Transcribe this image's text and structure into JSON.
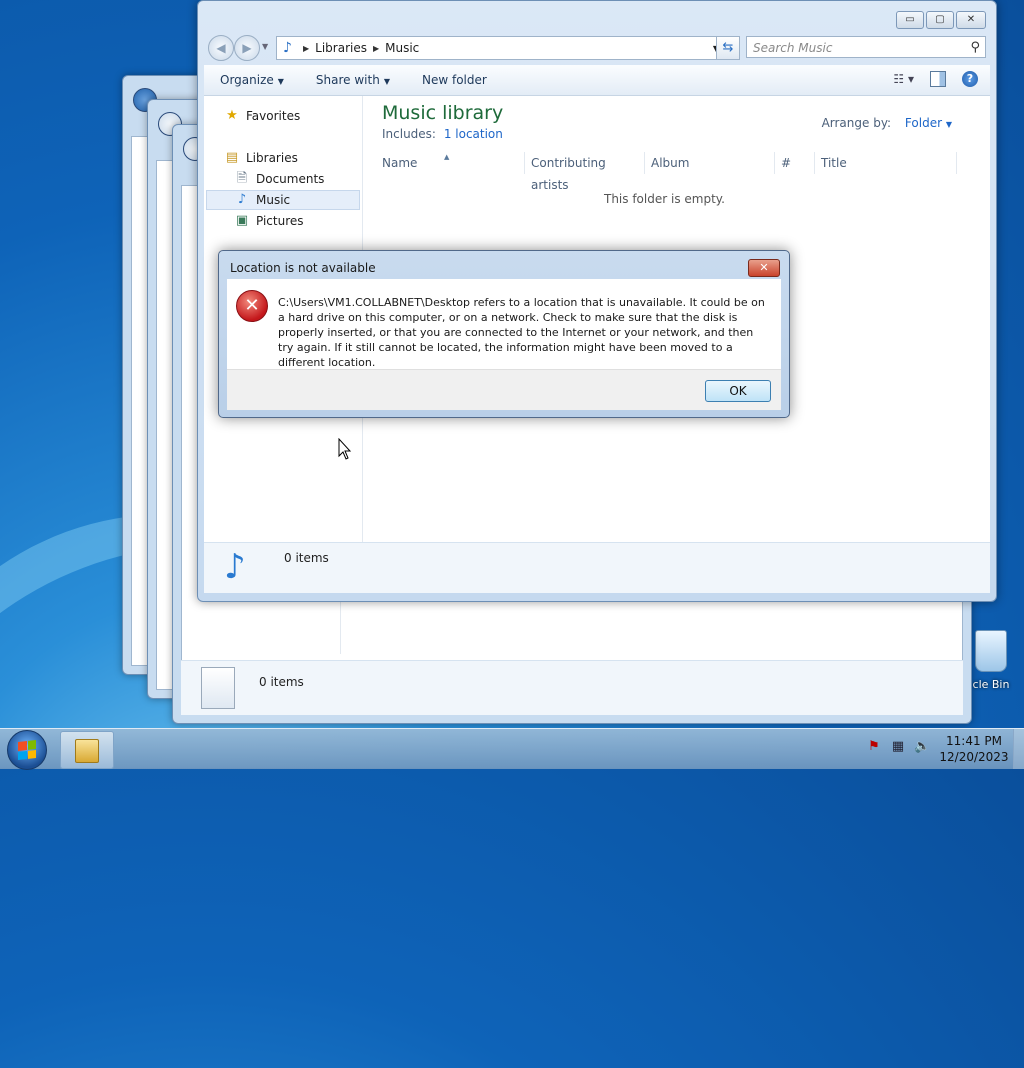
{
  "desktop": {
    "recycle_bin_label": "cle Bin"
  },
  "background_windows": {
    "status_text": "0 items"
  },
  "explorer": {
    "window_controls": {
      "minimize": "▭",
      "maximize": "▢",
      "close": "✕"
    },
    "address": {
      "crumb1": "Libraries",
      "crumb2": "Music"
    },
    "search_placeholder": "Search Music",
    "toolbar": {
      "organize": "Organize",
      "share_with": "Share with",
      "new_folder": "New folder"
    },
    "nav": {
      "favorites": "Favorites",
      "libraries": "Libraries",
      "documents": "Documents",
      "music": "Music",
      "pictures": "Pictures"
    },
    "library": {
      "title": "Music library",
      "includes_label": "Includes:",
      "includes_link": "1 location",
      "arrange_label": "Arrange by:",
      "arrange_value": "Folder"
    },
    "columns": [
      "Name",
      "Contributing artists",
      "Album",
      "#",
      "Title"
    ],
    "empty_message": "This folder is empty.",
    "status_text": "0 items"
  },
  "dialog": {
    "title": "Location is not available",
    "close_glyph": "✕",
    "message": "C:\\Users\\VM1.COLLABNET\\Desktop refers to a location that is unavailable. It could be on a hard drive on this computer, or on a network. Check to make sure that the disk is properly inserted, or that you are connected to the Internet or your network, and then try again. If it still cannot be located, the information might have been moved to a different location.",
    "ok_label": "OK"
  },
  "taskbar": {
    "time": "11:41 PM",
    "date": "12/20/2023"
  },
  "colors": {
    "library_title": "#1e6a3a",
    "link": "#1e66c8",
    "error": "#c4171b"
  }
}
